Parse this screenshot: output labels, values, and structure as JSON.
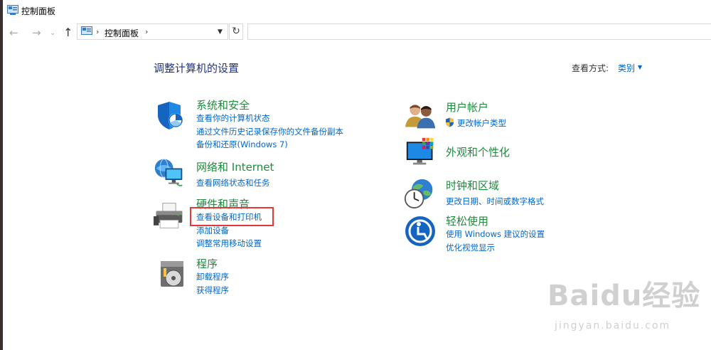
{
  "window": {
    "title": "控制面板"
  },
  "nav": {
    "back_icon": "arrow-left-icon",
    "forward_icon": "arrow-right-icon",
    "up_icon": "arrow-up-icon",
    "address": "控制面板",
    "refresh_icon": "refresh-icon"
  },
  "header": {
    "title": "调整计算机的设置",
    "view_label": "查看方式:",
    "view_value": "类别"
  },
  "categories_left": [
    {
      "title": "系统和安全",
      "icon": "shield-icon",
      "links": [
        "查看你的计算机状态",
        "通过文件历史记录保存你的文件备份副本",
        "备份和还原(Windows 7)"
      ]
    },
    {
      "title": "网络和 Internet",
      "icon": "network-globe-icon",
      "links": [
        "查看网络状态和任务"
      ]
    },
    {
      "title": "硬件和声音",
      "icon": "printer-icon",
      "links": [
        "查看设备和打印机",
        "添加设备",
        "调整常用移动设置"
      ]
    },
    {
      "title": "程序",
      "icon": "programs-disc-icon",
      "links": [
        "卸载程序",
        "获得程序"
      ]
    }
  ],
  "categories_right": [
    {
      "title": "用户帐户",
      "icon": "users-icon",
      "links": [
        "更改帐户类型"
      ]
    },
    {
      "title": "外观和个性化",
      "icon": "monitor-palette-icon",
      "links": []
    },
    {
      "title": "时钟和区域",
      "icon": "clock-globe-icon",
      "links": [
        "更改日期、时间或数字格式"
      ]
    },
    {
      "title": "轻松使用",
      "icon": "ease-of-access-icon",
      "links": [
        "使用 Windows 建议的设置",
        "优化视觉显示"
      ]
    }
  ],
  "watermark": {
    "logo": "Baidu经验",
    "url": "jingyan.baidu.com"
  },
  "colors": {
    "link": "#0066cc",
    "category_title": "#1e8a3c",
    "page_title": "#1e3287",
    "highlight": "#e53935"
  }
}
